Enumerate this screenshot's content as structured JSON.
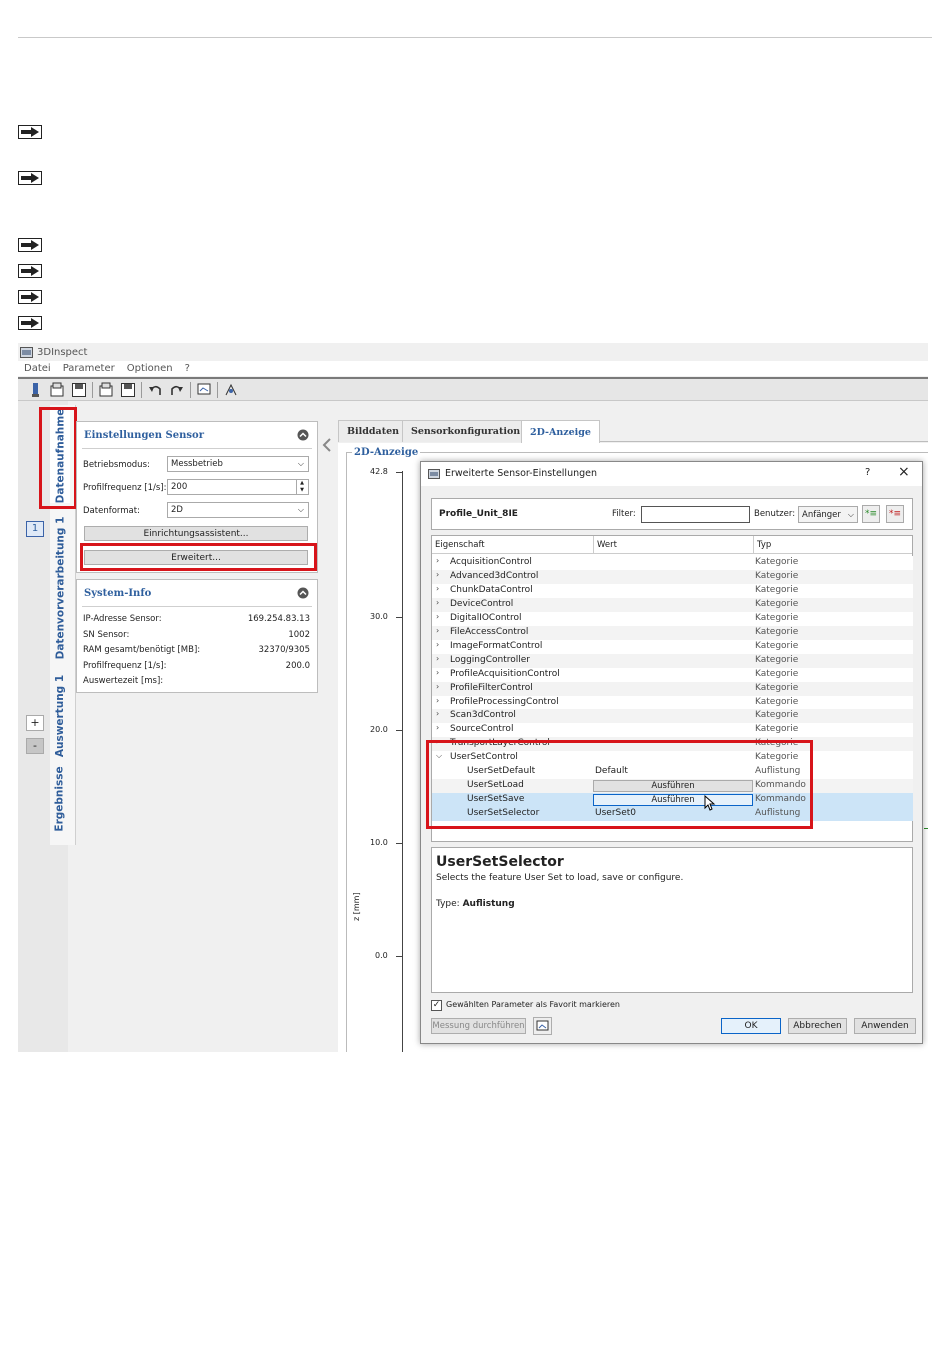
{
  "app": {
    "title": "3DInspect"
  },
  "menu": [
    "Datei",
    "Parameter",
    "Optionen",
    "?"
  ],
  "vertical_tabs": [
    "Datenaufnahme",
    "Datenvorverarbeitung 1",
    "Auswertung 1",
    "Ergebnisse"
  ],
  "side_controls": {
    "index": "1",
    "plus": "+",
    "minus": "-"
  },
  "sensor_panel": {
    "title": "Einstellungen Sensor",
    "fields": [
      {
        "label": "Betriebsmodus:",
        "value": "Messbetrieb"
      },
      {
        "label": "Profilfrequenz [1/s]:",
        "value": "200"
      },
      {
        "label": "Datenformat:",
        "value": "2D"
      }
    ],
    "wizard_button": "Einrichtungsassistent...",
    "advanced_button": "Erweitert..."
  },
  "system_info": {
    "title": "System-Info",
    "rows": [
      {
        "label": "IP-Adresse Sensor:",
        "value": "169.254.83.13"
      },
      {
        "label": "SN Sensor:",
        "value": "1002"
      },
      {
        "label": "RAM gesamt/benötigt [MB]:",
        "value": "32370/9305"
      },
      {
        "label": "Profilfrequenz [1/s]:",
        "value": "200.0"
      },
      {
        "label": "Auswertezeit [ms]:",
        "value": ""
      }
    ]
  },
  "main_tabs": [
    "Bilddaten",
    "Sensorkonfiguration",
    "2D-Anzeige"
  ],
  "plot": {
    "group_label": "2D-Anzeige",
    "y_ticks": [
      "42.8",
      "30.0",
      "20.0",
      "10.0",
      "0.0"
    ],
    "y_axis_label": "z [mm]"
  },
  "dialog": {
    "title": "Erweiterte Sensor-Einstellungen",
    "help": "?",
    "close": "×",
    "profile_name": "Profile_Unit_8IE",
    "filter_label": "Filter:",
    "filter_value": "",
    "user_label": "Benutzer:",
    "user_value": "Anfänger",
    "columns": [
      "Eigenschaft",
      "Wert",
      "Typ"
    ],
    "categories": [
      "AcquisitionControl",
      "Advanced3dControl",
      "ChunkDataControl",
      "DeviceControl",
      "DigitalIOControl",
      "FileAccessControl",
      "ImageFormatControl",
      "LoggingController",
      "ProfileAcquisitionControl",
      "ProfileFilterControl",
      "ProfileProcessingControl",
      "Scan3dControl",
      "SourceControl",
      "TransportLayerControl",
      "UserSetControl"
    ],
    "category_type": "Kategorie",
    "children": [
      {
        "name": "UserSetDefault",
        "value": "Default",
        "type": "Auflistung"
      },
      {
        "name": "UserSetLoad",
        "value": "Ausführen",
        "type": "Kommando"
      },
      {
        "name": "UserSetSave",
        "value": "Ausführen",
        "type": "Kommando"
      },
      {
        "name": "UserSetSelector",
        "value": "UserSet0",
        "type": "Auflistung"
      }
    ],
    "description_title": "UserSetSelector",
    "description_text": "Selects the feature User Set to load, save or configure.",
    "description_type_label": "Type:",
    "description_type_value": "Auflistung",
    "favorite_label": "Gewählten Parameter als Favorit markieren",
    "favorite_checked": true,
    "measure_button": "Messung durchführen",
    "ok": "OK",
    "cancel": "Abbrechen",
    "apply": "Anwenden"
  },
  "colors": {
    "highlight": "#d7141a",
    "accent": "#2e5f9e",
    "selection": "#cce4f7"
  }
}
